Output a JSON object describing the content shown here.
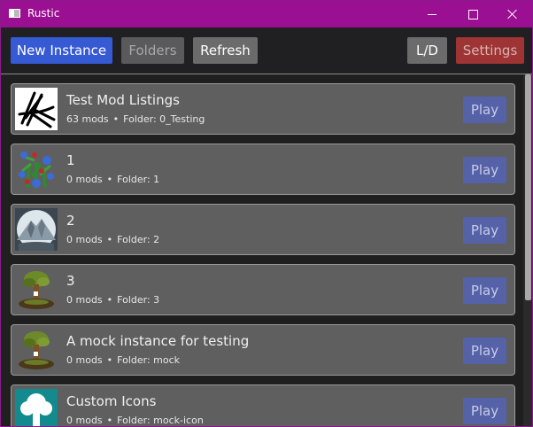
{
  "window": {
    "title": "Rustic",
    "title_bar_color": "#9b0f92"
  },
  "toolbar": {
    "new_instance": "New Instance",
    "folders": "Folders",
    "refresh": "Refresh",
    "ld": "L/D",
    "settings": "Settings"
  },
  "instances": [
    {
      "name": "Test Mod Listings",
      "mods": "63 mods",
      "folder": "Folder: 0_Testing",
      "icon": "scribble-logo-icon",
      "play": "Play"
    },
    {
      "name": "1",
      "mods": "0 mods",
      "folder": "Folder: 1",
      "icon": "flowers-icon",
      "play": "Play"
    },
    {
      "name": "2",
      "mods": "0 mods",
      "folder": "Folder: 2",
      "icon": "mountain-icon",
      "play": "Play"
    },
    {
      "name": "3",
      "mods": "0 mods",
      "folder": "Folder: 3",
      "icon": "tree-icon",
      "play": "Play"
    },
    {
      "name": "A mock instance for testing",
      "mods": "0 mods",
      "folder": "Folder: mock",
      "icon": "tree-icon",
      "play": "Play"
    },
    {
      "name": "Custom Icons",
      "mods": "0 mods",
      "folder": "Folder: mock-icon",
      "icon": "cloud-tree-icon",
      "play": "Play"
    }
  ],
  "separator": "•"
}
